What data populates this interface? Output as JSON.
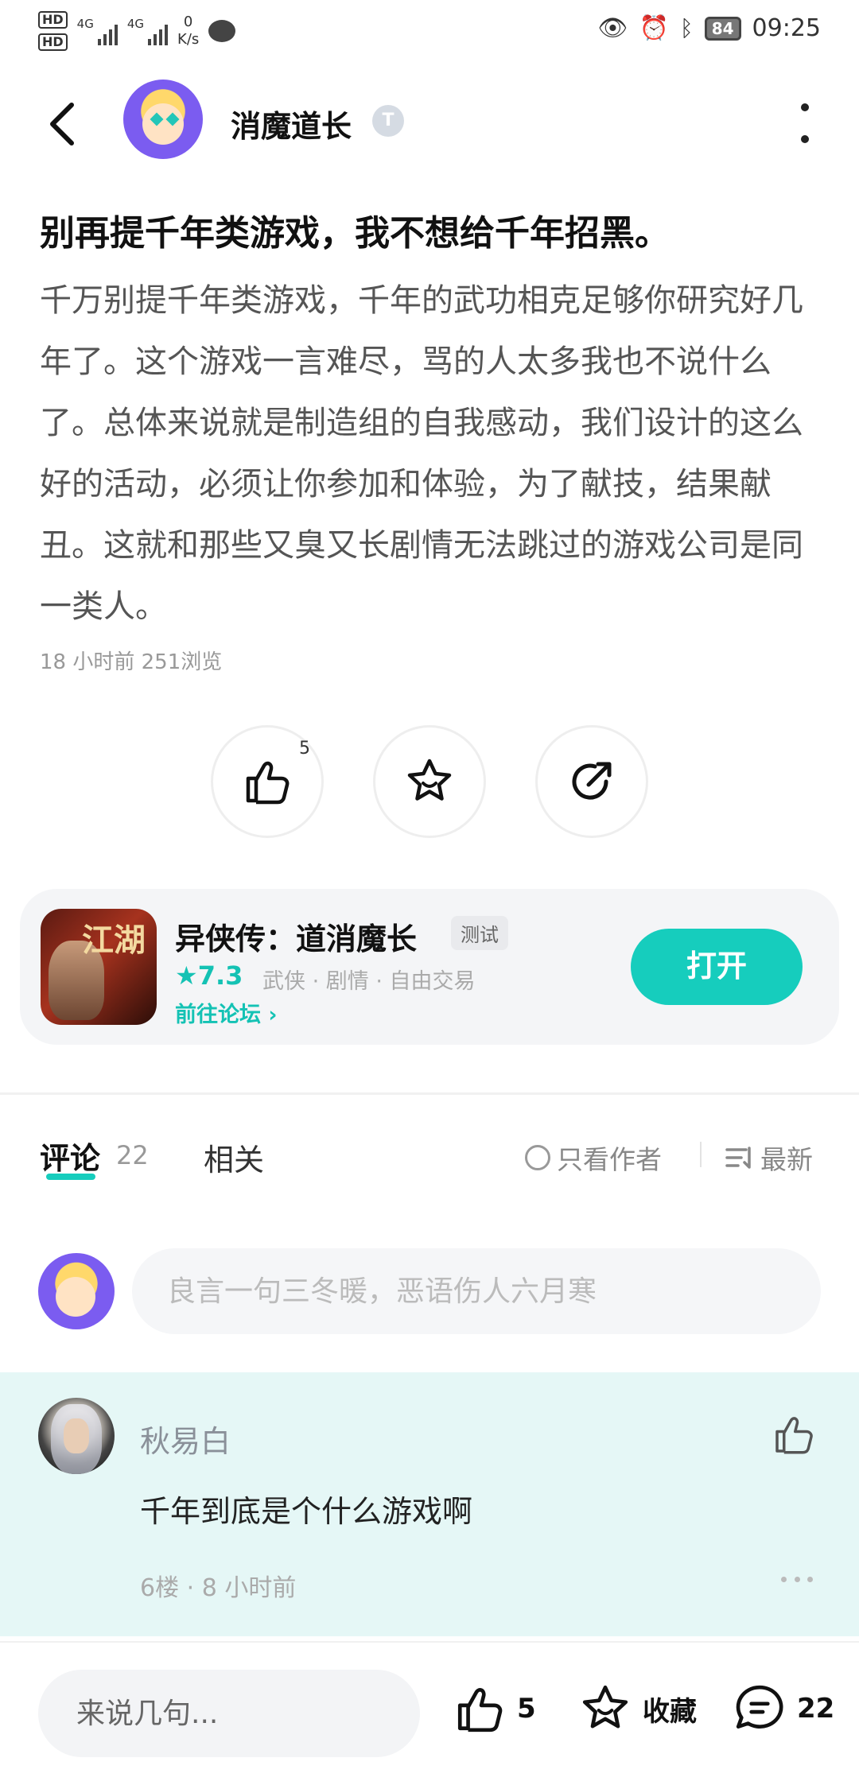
{
  "status_bar": {
    "hd1": "HD",
    "hd2": "HD",
    "net1": "4G",
    "net2": "4G",
    "speed_value": "0",
    "speed_unit": "K/s",
    "battery": "84",
    "time": "09:25"
  },
  "header": {
    "author_name": "消魔道长",
    "badge": "T"
  },
  "post": {
    "title": "别再提千年类游戏，我不想给千年招黑。",
    "body": "千万别提千年类游戏，千年的武功相克足够你研究好几年了。这个游戏一言难尽，骂的人太多我也不说什么了。总体来说就是制造组的自我感动，我们设计的这么好的活动，必须让你参加和体验，为了献技，结果献丑。这就和那些又臭又长剧情无法跳过的游戏公司是同一类人。",
    "meta": "18 小时前  251浏览",
    "like_count": "5"
  },
  "game": {
    "icon_text": "江湖",
    "name": "异侠传：道消魔长",
    "tag": "测试",
    "rating": "★7.3",
    "genres": "武侠 · 剧情 · 自由交易",
    "forum_link": "前往论坛 ›",
    "open_button": "打开"
  },
  "tabs": {
    "comments_label": "评论",
    "comments_count": "22",
    "related_label": "相关",
    "author_only": "只看作者",
    "sort": "最新"
  },
  "comment_input": {
    "placeholder": "良言一句三冬暖，恶语伤人六月寒"
  },
  "comments": [
    {
      "user": "秋易白",
      "text": "千年到底是个什么游戏啊",
      "meta": "6楼 · 8 小时前"
    }
  ],
  "bottom_bar": {
    "placeholder": "来说几句...",
    "like_count": "5",
    "favorite_label": "收藏",
    "comment_count": "22"
  },
  "colors": {
    "accent": "#16cdbd",
    "comment_highlight": "#e5f7f6"
  }
}
